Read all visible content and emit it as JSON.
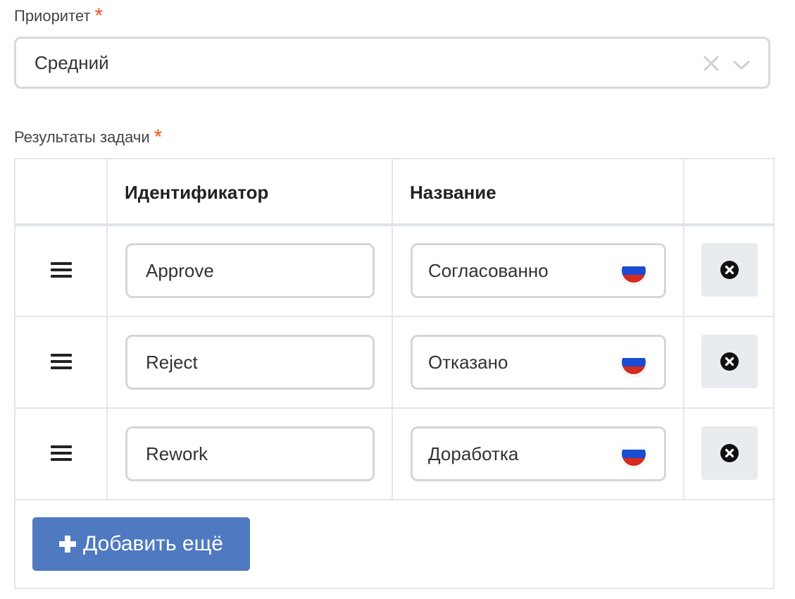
{
  "priority": {
    "label": "Приоритет",
    "required_mark": "*",
    "selected_value": "Средний"
  },
  "results": {
    "label": "Результаты задачи",
    "required_mark": "*",
    "columns": [
      "",
      "Идентификатор",
      "Название",
      ""
    ],
    "rows": [
      {
        "id": "Approve",
        "name": "Согласованно",
        "lang_flag": "ru-flag-icon"
      },
      {
        "id": "Reject",
        "name": "Отказано",
        "lang_flag": "ru-flag-icon"
      },
      {
        "id": "Rework",
        "name": "Доработка",
        "lang_flag": "ru-flag-icon"
      }
    ],
    "add_button_label": "Добавить ещё"
  },
  "colors": {
    "required": "#f4511e",
    "add_button_bg": "#4f79c0",
    "delete_button_bg": "#e8ecef",
    "flag_white": "#ffffff",
    "flag_blue": "#1a4bd3",
    "flag_red": "#d52b1e"
  },
  "icons": {
    "clear": "close-icon",
    "dropdown": "chevron-down-icon",
    "drag": "drag-handle-icon",
    "delete": "times-circle-icon",
    "add": "plus-icon"
  }
}
